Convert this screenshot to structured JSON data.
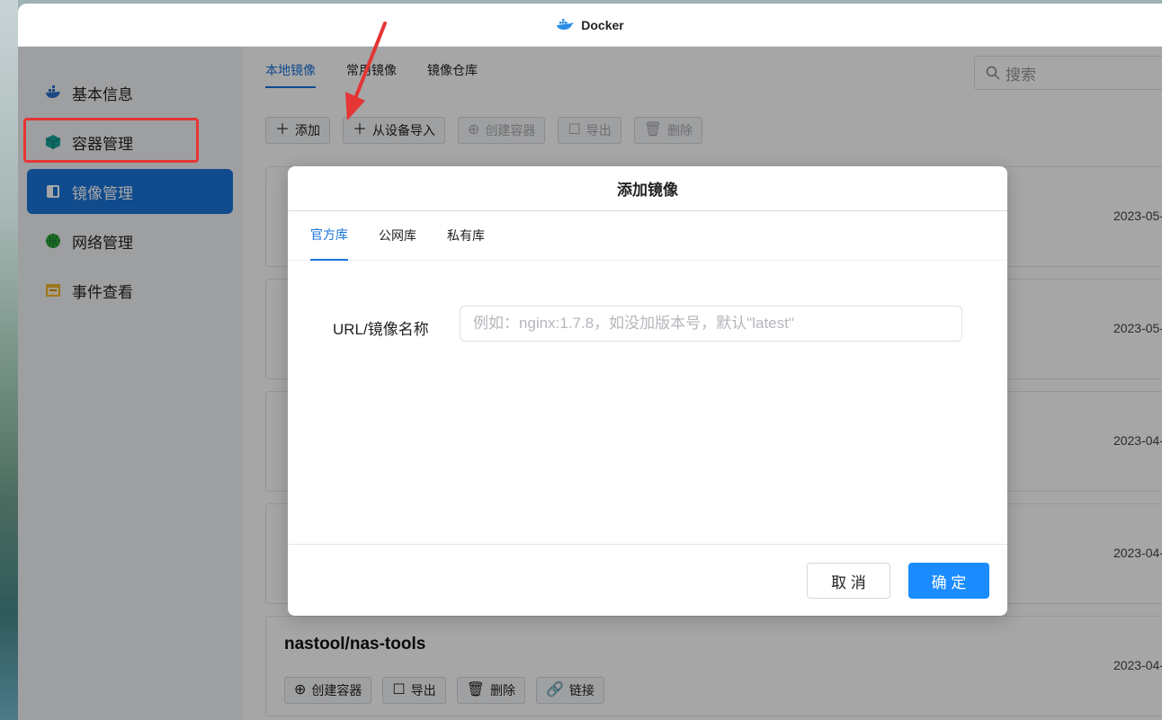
{
  "window": {
    "title": "Docker"
  },
  "sidebar": {
    "items": [
      {
        "label": "基本信息",
        "icon": "docker-whale-icon"
      },
      {
        "label": "容器管理",
        "icon": "cube-icon"
      },
      {
        "label": "镜像管理",
        "icon": "image-layers-icon",
        "active": true
      },
      {
        "label": "网络管理",
        "icon": "globe-icon"
      },
      {
        "label": "事件查看",
        "icon": "calendar-icon"
      }
    ]
  },
  "main": {
    "tabs": [
      {
        "label": "本地镜像",
        "active": true
      },
      {
        "label": "常用镜像"
      },
      {
        "label": "镜像仓库"
      }
    ],
    "search": {
      "placeholder": "搜索"
    },
    "toolbar": {
      "add": "添加",
      "import": "从设备导入",
      "create_container": "创建容器",
      "export": "导出",
      "delete": "删除"
    },
    "images": [
      {
        "name": "",
        "date": "2023-05-"
      },
      {
        "name": "",
        "date": "2023-05-"
      },
      {
        "name": "",
        "date": "2023-04-"
      },
      {
        "name": "",
        "date": "2023-04-"
      },
      {
        "name": "nastool/nas-tools",
        "date": "2023-04-"
      }
    ],
    "card_actions": {
      "create_container": "创建容器",
      "export": "导出",
      "delete": "删除",
      "link": "链接"
    }
  },
  "dialog": {
    "title": "添加镜像",
    "tabs": [
      {
        "label": "官方库",
        "active": true
      },
      {
        "label": "公网库"
      },
      {
        "label": "私有库"
      }
    ],
    "field_label": "URL/镜像名称",
    "field_placeholder": "例如：nginx:1.7.8，如没加版本号，默认\"latest\"",
    "field_value": "",
    "cancel": "取 消",
    "ok": "确 定"
  },
  "colors": {
    "accent": "#1a74d9",
    "primary_button": "#1a8cff",
    "annotation": "#e53535"
  }
}
